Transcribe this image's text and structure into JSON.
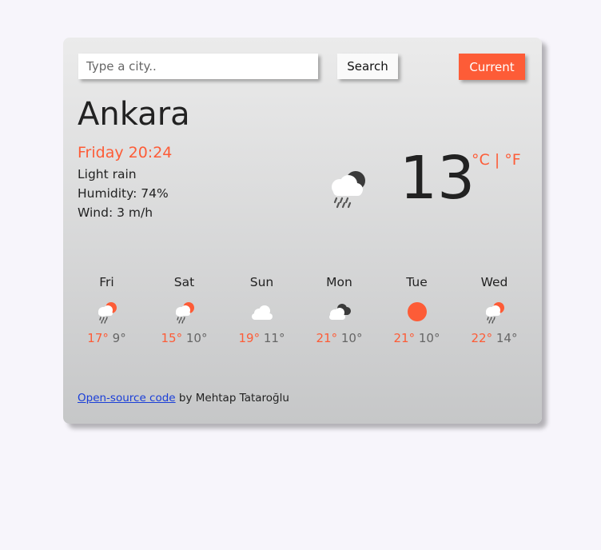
{
  "search": {
    "placeholder": "Type a city..",
    "search_label": "Search",
    "current_label": "Current"
  },
  "weather": {
    "city": "Ankara",
    "date_time": "Friday 20:24",
    "description": "Light rain",
    "humidity": "Humidity: 74%",
    "wind": "Wind: 3 m/h",
    "temperature": "13",
    "icon": "night-cloud-rain-icon",
    "unit_celsius": "°C",
    "unit_separator": " | ",
    "unit_fahrenheit": "°F"
  },
  "forecast": [
    {
      "day": "Fri",
      "max": "17°",
      "min": "9°",
      "icon": "sun-cloud-rain-icon"
    },
    {
      "day": "Sat",
      "max": "15°",
      "min": "10°",
      "icon": "sun-cloud-rain-icon"
    },
    {
      "day": "Sun",
      "max": "19°",
      "min": "11°",
      "icon": "cloud-icon"
    },
    {
      "day": "Mon",
      "max": "21°",
      "min": "10°",
      "icon": "dark-clouds-icon"
    },
    {
      "day": "Tue",
      "max": "21°",
      "min": "10°",
      "icon": "sun-icon"
    },
    {
      "day": "Wed",
      "max": "22°",
      "min": "14°",
      "icon": "sun-cloud-rain-icon"
    }
  ],
  "footer": {
    "link_text": "Open-source code",
    "suffix": " by Mehtap Tataroğlu"
  },
  "colors": {
    "accent": "#fd5c37",
    "link": "#1a3ed8",
    "background": "#f7f5fb"
  }
}
